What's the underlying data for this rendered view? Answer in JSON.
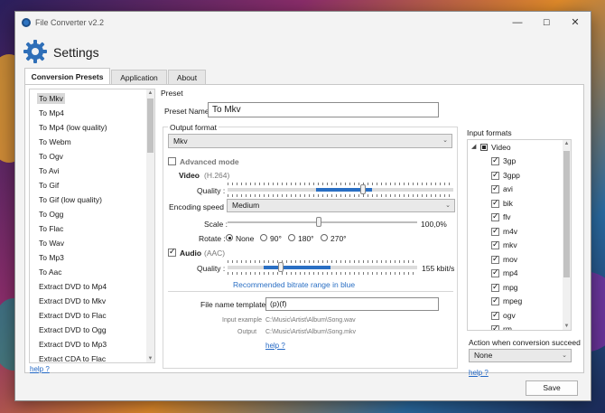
{
  "window": {
    "title": "File Converter v2.2",
    "page_title": "Settings",
    "minimize_glyph": "—",
    "maximize_glyph": "☐",
    "close_glyph": "✕"
  },
  "tabs": [
    {
      "label": "Conversion Presets",
      "active": true
    },
    {
      "label": "Application",
      "active": false
    },
    {
      "label": "About",
      "active": false
    }
  ],
  "presets": {
    "items": [
      "To Mkv",
      "To Mp4",
      "To Mp4 (low quality)",
      "To Webm",
      "To Ogv",
      "To Avi",
      "To Gif",
      "To Gif (low quality)",
      "To Ogg",
      "To Flac",
      "To Wav",
      "To Mp3",
      "To Aac",
      "Extract DVD to Mp4",
      "Extract DVD to Mkv",
      "Extract DVD to Flac",
      "Extract DVD to Ogg",
      "Extract DVD to Mp3",
      "Extract CDA to Flac"
    ],
    "selected_index": 0,
    "help": "help ?"
  },
  "preset": {
    "group_label": "Preset",
    "name_label": "Preset Name",
    "name_value": "To Mkv",
    "output_format_label": "Output format",
    "output_format_value": "Mkv",
    "advanced_mode_label": "Advanced mode",
    "advanced_mode_checked": false,
    "video": {
      "label": "Video",
      "codec": "(H.264)",
      "quality_label": "Quality :",
      "quality_value": 0.6,
      "encoding_speed_label": "Encoding speed :",
      "encoding_speed_value": "Medium",
      "scale_label": "Scale :",
      "scale_value": "100,0%",
      "rotate_label": "Rotate :",
      "rotate_options": [
        "None",
        "90°",
        "180°",
        "270°"
      ],
      "rotate_selected": 0
    },
    "audio": {
      "label": "Audio",
      "codec": "(AAC)",
      "enabled": true,
      "quality_label": "Quality :",
      "quality_text": "155 kbit/s",
      "quality_value": 0.28,
      "recommended_note": "Recommended bitrate range in blue"
    },
    "file_name_template_label": "File name template",
    "file_name_template_value": "(p)(f)",
    "input_example_label": "Input example",
    "input_example_value": "C:\\Music\\Artist\\Album\\Song.wav",
    "output_label": "Output",
    "output_value": "C:\\Music\\Artist\\Album\\Song.mkv",
    "help": "help ?"
  },
  "input_formats": {
    "label": "Input formats",
    "root": "Video",
    "items": [
      "3gp",
      "3gpp",
      "avi",
      "bik",
      "flv",
      "m4v",
      "mkv",
      "mov",
      "mp4",
      "mpg",
      "mpeg",
      "ogv",
      "rm"
    ],
    "action_label": "Action when conversion succeed",
    "action_value": "None",
    "help": "help ?"
  },
  "footer": {
    "save_label": "Save"
  },
  "colors": {
    "accent": "#2a6fc4",
    "link": "#2267c4"
  }
}
